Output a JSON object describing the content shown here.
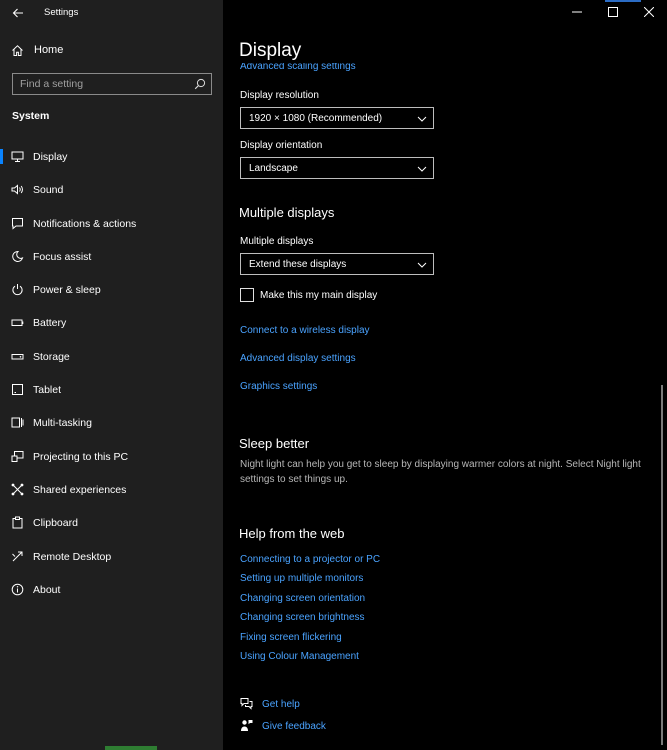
{
  "window": {
    "title": "Settings"
  },
  "sidebar": {
    "home_label": "Home",
    "search": {
      "placeholder": "Find a setting"
    },
    "section_title": "System",
    "items": [
      {
        "label": "Display",
        "icon": "monitor-icon",
        "active": true
      },
      {
        "label": "Sound",
        "icon": "speaker-icon"
      },
      {
        "label": "Notifications & actions",
        "icon": "notification-icon"
      },
      {
        "label": "Focus assist",
        "icon": "moon-icon"
      },
      {
        "label": "Power & sleep",
        "icon": "power-icon"
      },
      {
        "label": "Battery",
        "icon": "battery-icon"
      },
      {
        "label": "Storage",
        "icon": "storage-icon"
      },
      {
        "label": "Tablet",
        "icon": "tablet-icon"
      },
      {
        "label": "Multi-tasking",
        "icon": "multitasking-icon"
      },
      {
        "label": "Projecting to this PC",
        "icon": "projecting-icon"
      },
      {
        "label": "Shared experiences",
        "icon": "shared-experiences-icon"
      },
      {
        "label": "Clipboard",
        "icon": "clipboard-icon"
      },
      {
        "label": "Remote Desktop",
        "icon": "remote-desktop-icon"
      },
      {
        "label": "About",
        "icon": "info-icon"
      }
    ]
  },
  "main": {
    "title": "Display",
    "cut_link": "Advanced scaling settings",
    "resolution": {
      "label": "Display resolution",
      "value": "1920 × 1080 (Recommended)"
    },
    "orientation": {
      "label": "Display orientation",
      "value": "Landscape"
    },
    "multiple_displays": {
      "heading": "Multiple displays",
      "label": "Multiple displays",
      "value": "Extend these displays",
      "checkbox_label": "Make this my main display",
      "checkbox_checked": false
    },
    "links": {
      "wireless": "Connect to a wireless display",
      "advanced": "Advanced display settings",
      "graphics": "Graphics settings"
    },
    "sleep_better": {
      "heading": "Sleep better",
      "text": "Night light can help you get to sleep by displaying warmer colors at night. Select Night light settings to set things up."
    },
    "help_web": {
      "heading": "Help from the web",
      "links": [
        "Connecting to a projector or PC",
        "Setting up multiple monitors",
        "Changing screen orientation",
        "Changing screen brightness",
        "Fixing screen flickering",
        "Using Colour Management"
      ]
    },
    "get_help": "Get help",
    "give_feedback": "Give feedback"
  },
  "colors": {
    "accent": "#0a84ff",
    "link": "#4aa3ff",
    "sidebar_bg": "#1f1f1f",
    "main_bg": "#000000"
  }
}
